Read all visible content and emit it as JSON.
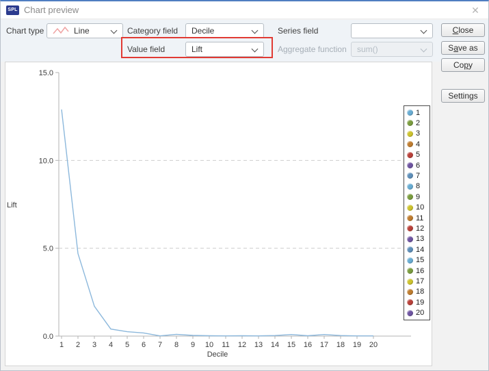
{
  "window": {
    "title": "Chart preview",
    "app_badge": "SPL"
  },
  "toolbar": {
    "chart_type": {
      "label": "Chart type",
      "value": "Line"
    },
    "category_field": {
      "label": "Category field",
      "value": "Decile"
    },
    "series_field": {
      "label": "Series field",
      "value": ""
    },
    "value_field": {
      "label": "Value field",
      "value": "Lift"
    },
    "aggregate_function": {
      "label": "Aggregate function",
      "value": "sum()"
    },
    "highlight_color": "#e13a33"
  },
  "buttons": {
    "close": {
      "pre": "",
      "key": "C",
      "post": "lose"
    },
    "save_as": {
      "pre": "S",
      "key": "a",
      "post": "ve as"
    },
    "copy": {
      "pre": "Co",
      "key": "p",
      "post": "y"
    },
    "settings": {
      "label": "Settings"
    }
  },
  "chart_data": {
    "type": "line",
    "title": "",
    "xlabel": "Decile",
    "ylabel": "Lift",
    "x": [
      1,
      2,
      3,
      4,
      5,
      6,
      7,
      8,
      9,
      10,
      11,
      12,
      13,
      14,
      15,
      16,
      17,
      18,
      19,
      20
    ],
    "values": [
      12.9,
      4.7,
      1.7,
      0.4,
      0.25,
      0.18,
      0.01,
      0.1,
      0.04,
      0.02,
      0.01,
      0.02,
      0.01,
      0.03,
      0.09,
      0.02,
      0.09,
      0.03,
      0.01,
      0.01
    ],
    "ylim": [
      0,
      15
    ],
    "yticks": [
      0,
      5,
      10,
      15
    ],
    "ytick_labels": [
      "0.0",
      "5.0",
      "10.0",
      "15.0"
    ],
    "dashed_gridlines": [
      5,
      10
    ],
    "grid": "dashed-horizontal",
    "line_color": "#8cb8dc",
    "axis_color": "#b3b3b3",
    "gridline_color": "#cdcdcd",
    "legend": {
      "position": "right",
      "entries": [
        {
          "label": "1",
          "color": "#69add3"
        },
        {
          "label": "2",
          "color": "#7b9d3f"
        },
        {
          "label": "3",
          "color": "#cdc32e"
        },
        {
          "label": "4",
          "color": "#bf7d30"
        },
        {
          "label": "5",
          "color": "#b9413a"
        },
        {
          "label": "6",
          "color": "#6f55a2"
        },
        {
          "label": "7",
          "color": "#5f90ba"
        },
        {
          "label": "8",
          "color": "#69add3"
        },
        {
          "label": "9",
          "color": "#7b9d3f"
        },
        {
          "label": "10",
          "color": "#cdc32e"
        },
        {
          "label": "11",
          "color": "#bf7d30"
        },
        {
          "label": "12",
          "color": "#b9413a"
        },
        {
          "label": "13",
          "color": "#6f55a2"
        },
        {
          "label": "14",
          "color": "#5f90ba"
        },
        {
          "label": "15",
          "color": "#69add3"
        },
        {
          "label": "16",
          "color": "#7b9d3f"
        },
        {
          "label": "17",
          "color": "#cdc32e"
        },
        {
          "label": "18",
          "color": "#bf7d30"
        },
        {
          "label": "19",
          "color": "#b9413a"
        },
        {
          "label": "20",
          "color": "#6f55a2"
        }
      ]
    }
  }
}
